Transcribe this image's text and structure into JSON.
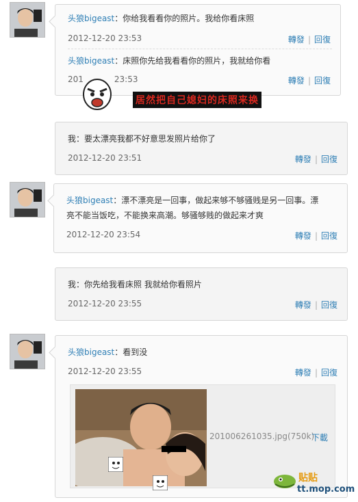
{
  "thread": {
    "messages": [
      {
        "user": "头狼bigeast",
        "text": "：你给我看看你的照片。我给你看床照",
        "time": "2012-12-20 23:53"
      },
      {
        "user": "头狼bigeast",
        "text": "：床照你先给我看看你的照片，我就给你看",
        "time": "2012-12-20 23:53",
        "time_prefix": "201"
      },
      {
        "user": "",
        "text": "我：要太漂亮我都不好意思发照片给你了",
        "time": "2012-12-20 23:51"
      },
      {
        "user": "头狼bigeast",
        "text": "：漂不漂亮是一回事，做起来够不够骚贱是另一回事。漂",
        "text2": "亮不能当饭吃，不能换来高潮。够骚够贱的做起来才爽",
        "time": "2012-12-20 23:54"
      },
      {
        "user": "",
        "text": "我：你先给我看床照 我就给你看照片",
        "time": "2012-12-20 23:55"
      },
      {
        "user": "头狼bigeast",
        "text": "：看到没",
        "time": "2012-12-20 23:55"
      }
    ],
    "actions": {
      "forward": "轉發",
      "reply": "回復",
      "separator": "|"
    }
  },
  "caption": "居然把自己媳妇的床照来换",
  "attachment": {
    "filename": "201006261035.jpg(750k)",
    "download": "下載"
  },
  "watermark": {
    "cn": "贴贴",
    "domain": "tt.mop.com"
  },
  "colors": {
    "link": "#2f7fb5",
    "caption": "#d9281f",
    "bubble_border": "#d6d6d6"
  }
}
